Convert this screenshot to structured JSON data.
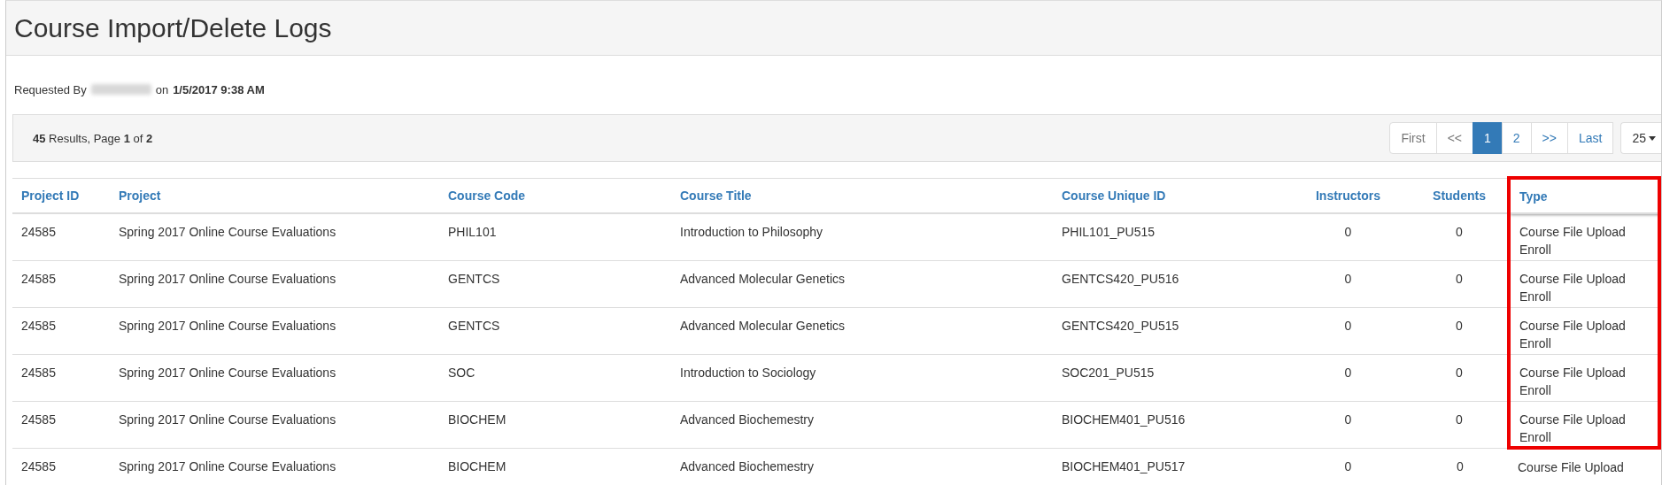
{
  "page_title": "Course Import/Delete Logs",
  "request": {
    "prefix": "Requested By",
    "requester_hidden": true,
    "connector": "on",
    "timestamp": "1/5/2017 9:38 AM"
  },
  "results": {
    "count": "45",
    "text1": "Results, Page",
    "page": "1",
    "text2": "of",
    "pages": "2"
  },
  "pagination": [
    {
      "label": "First",
      "disabled": true,
      "selected": false
    },
    {
      "label": "<<",
      "disabled": true,
      "selected": false
    },
    {
      "label": "1",
      "disabled": false,
      "selected": true
    },
    {
      "label": "2",
      "disabled": false,
      "selected": false
    },
    {
      "label": ">>",
      "disabled": false,
      "selected": false
    },
    {
      "label": "Last",
      "disabled": false,
      "selected": false
    }
  ],
  "page_size": "25",
  "table": {
    "columns": [
      {
        "label": "Project ID",
        "highlighted": false
      },
      {
        "label": "Project",
        "highlighted": false
      },
      {
        "label": "Course Code",
        "highlighted": false
      },
      {
        "label": "Course Title",
        "highlighted": false
      },
      {
        "label": "Course Unique ID",
        "highlighted": false
      },
      {
        "label": "Instructors",
        "highlighted": false
      },
      {
        "label": "Students",
        "highlighted": false
      },
      {
        "label": "Type",
        "highlighted": true
      }
    ],
    "rows": [
      {
        "highlighted": true,
        "cells": [
          "24585",
          "Spring 2017 Online Course Evaluations",
          "PHIL101",
          "Introduction to Philosophy",
          "PHIL101_PU515",
          "0",
          "0",
          [
            "Course File Upload",
            "Enroll"
          ]
        ]
      },
      {
        "highlighted": true,
        "cells": [
          "24585",
          "Spring 2017 Online Course Evaluations",
          "GENTCS",
          "Advanced Molecular Genetics",
          "GENTCS420_PU516",
          "0",
          "0",
          [
            "Course File Upload",
            "Enroll"
          ]
        ]
      },
      {
        "highlighted": true,
        "cells": [
          "24585",
          "Spring 2017 Online Course Evaluations",
          "GENTCS",
          "Advanced Molecular Genetics",
          "GENTCS420_PU515",
          "0",
          "0",
          [
            "Course File Upload",
            "Enroll"
          ]
        ]
      },
      {
        "highlighted": true,
        "cells": [
          "24585",
          "Spring 2017 Online Course Evaluations",
          "SOC",
          "Introduction to Sociology",
          "SOC201_PU515",
          "0",
          "0",
          [
            "Course File Upload",
            "Enroll"
          ]
        ]
      },
      {
        "highlighted": true,
        "cells": [
          "24585",
          "Spring 2017 Online Course Evaluations",
          "BIOCHEM",
          "Advanced Biochemestry",
          "BIOCHEM401_PU516",
          "0",
          "0",
          [
            "Course File Upload",
            "Enroll"
          ]
        ]
      },
      {
        "highlighted": false,
        "cells": [
          "24585",
          "Spring 2017 Online Course Evaluations",
          "BIOCHEM",
          "Advanced Biochemestry",
          "BIOCHEM401_PU517",
          "0",
          "0",
          [
            "Course File Upload"
          ]
        ]
      }
    ]
  }
}
